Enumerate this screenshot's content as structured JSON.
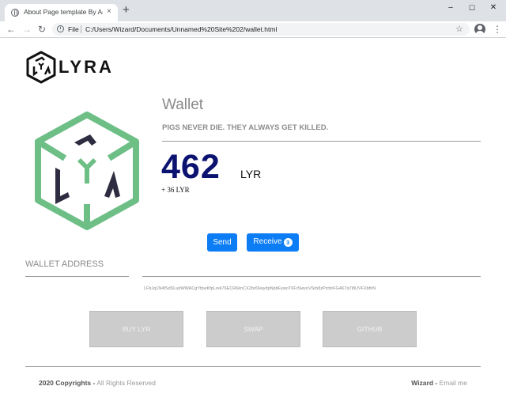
{
  "browser": {
    "tab_title": "About Page template By Adobe",
    "tab_close": "×",
    "new_tab": "+",
    "window_controls": {
      "minimize": "–",
      "maximize": "☐",
      "close": "✕"
    },
    "file_label": "File",
    "url": "C:/Users/Wizard/Documents/Unnamed%20Site%202/wallet.html",
    "icons": [
      "globe-icon",
      "back-arrow-icon",
      "forward-arrow-icon",
      "reload-icon",
      "info-icon",
      "star-icon",
      "profile-icon",
      "kebab-menu-icon"
    ]
  },
  "brand": {
    "name": "LYRA"
  },
  "wallet": {
    "title": "Wallet",
    "tagline": "PIGS NEVER DIE. THEY ALWAYS GET KILLED.",
    "balance": "462",
    "unit": "LYR",
    "change": "+ 36 LYR"
  },
  "actions": {
    "send": "Send",
    "receive": "Receive",
    "receive_badge": "3"
  },
  "address": {
    "heading": "WALLET ADDRESS",
    "value": "LFbJq1N4fSdSLudWWACgYfpwKfpLrek76ECR6knCX2br66wydpNpbFywoT6FrSwvoVSrb8zPzrbrFG4K7q7i8UVFXbfnN"
  },
  "buttons": {
    "buy": "BUY LYR",
    "swap": "SWAP",
    "github": "GITHUB"
  },
  "footer": {
    "copyright_strong": "2020 Copyrights -",
    "copyright_muted": " All Rights Reserved",
    "author_strong": "Wizard -",
    "author_muted": " Email me"
  },
  "colors": {
    "accent_blue": "#0d7df5",
    "balance_navy": "#0b1270",
    "logo_green": "#6dbf86",
    "logo_dark": "#2e2c40",
    "button_gray": "#cccccc"
  }
}
